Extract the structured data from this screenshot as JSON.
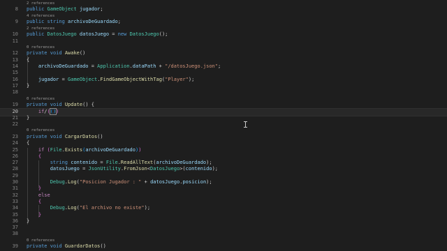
{
  "editor": {
    "lines": [
      {
        "ln": "8",
        "lens": "2 references",
        "tokens": [
          {
            "t": "public",
            "c": "kw"
          },
          {
            "t": " "
          },
          {
            "t": "GameObject",
            "c": "ty"
          },
          {
            "t": " "
          },
          {
            "t": "jugador",
            "c": "id"
          },
          {
            "t": ";"
          }
        ]
      },
      {
        "ln": "9",
        "lens": "4 references",
        "tokens": [
          {
            "t": "public",
            "c": "kw"
          },
          {
            "t": " "
          },
          {
            "t": "string",
            "c": "kw"
          },
          {
            "t": " "
          },
          {
            "t": "archivoDeGuardado",
            "c": "id"
          },
          {
            "t": ";"
          }
        ]
      },
      {
        "ln": "10",
        "lens": "2 references",
        "tokens": [
          {
            "t": "public",
            "c": "kw"
          },
          {
            "t": " "
          },
          {
            "t": "DatosJuego",
            "c": "ty"
          },
          {
            "t": " "
          },
          {
            "t": "datosJuego",
            "c": "id"
          },
          {
            "t": " = "
          },
          {
            "t": "new",
            "c": "kw"
          },
          {
            "t": " "
          },
          {
            "t": "DatosJuego",
            "c": "ty"
          },
          {
            "t": "();"
          }
        ]
      },
      {
        "ln": "11",
        "tokens": []
      },
      {
        "ln": "12",
        "lens": "0 references",
        "tokens": [
          {
            "t": "private",
            "c": "kw"
          },
          {
            "t": " "
          },
          {
            "t": "void",
            "c": "kw"
          },
          {
            "t": " "
          },
          {
            "t": "Awake",
            "c": "fn"
          },
          {
            "t": "()"
          }
        ]
      },
      {
        "ln": "13",
        "tokens": [
          {
            "t": "{"
          }
        ]
      },
      {
        "ln": "14",
        "tokens": [
          {
            "t": "    "
          },
          {
            "t": "archivoDeGuardado",
            "c": "id"
          },
          {
            "t": " = "
          },
          {
            "t": "Application",
            "c": "ty"
          },
          {
            "t": "."
          },
          {
            "t": "dataPath",
            "c": "id"
          },
          {
            "t": " + "
          },
          {
            "t": "\"/datosJuego.json\"",
            "c": "str"
          },
          {
            "t": ";"
          }
        ]
      },
      {
        "ln": "15",
        "tokens": []
      },
      {
        "ln": "16",
        "tokens": [
          {
            "t": "    "
          },
          {
            "t": "jugador",
            "c": "id"
          },
          {
            "t": " = "
          },
          {
            "t": "GameObject",
            "c": "ty"
          },
          {
            "t": "."
          },
          {
            "t": "FindGameObjectWithTag",
            "c": "fn"
          },
          {
            "t": "("
          },
          {
            "t": "\"Player\"",
            "c": "str"
          },
          {
            "t": ");"
          }
        ]
      },
      {
        "ln": "17",
        "tokens": [
          {
            "t": "}"
          }
        ]
      },
      {
        "ln": "18",
        "tokens": []
      },
      {
        "ln": "19",
        "lens": "0 references",
        "tokens": [
          {
            "t": "private",
            "c": "kw"
          },
          {
            "t": " "
          },
          {
            "t": "void",
            "c": "kw"
          },
          {
            "t": " "
          },
          {
            "t": "Update",
            "c": "fn"
          },
          {
            "t": "()"
          },
          {
            "t": " {"
          }
        ]
      },
      {
        "ln": "20",
        "current": true,
        "tokens": [
          {
            "t": "    "
          },
          {
            "t": "if",
            "c": "ctl"
          },
          {
            "t": "/"
          },
          {
            "t": "(",
            "c": "br2"
          },
          {
            "t": "()",
            "c": "br3 cursor-box"
          },
          {
            "t": ")",
            "c": "br2"
          }
        ]
      },
      {
        "ln": "21",
        "tokens": [
          {
            "t": "}"
          }
        ]
      },
      {
        "ln": "22",
        "tokens": []
      },
      {
        "ln": "23",
        "lens": "0 references",
        "tokens": [
          {
            "t": "private",
            "c": "kw"
          },
          {
            "t": " "
          },
          {
            "t": "void",
            "c": "kw"
          },
          {
            "t": " "
          },
          {
            "t": "CargarDatos",
            "c": "fn"
          },
          {
            "t": "()"
          }
        ]
      },
      {
        "ln": "24",
        "tokens": [
          {
            "t": "{"
          }
        ]
      },
      {
        "ln": "25",
        "tokens": [
          {
            "t": "    "
          },
          {
            "t": "if",
            "c": "ctl"
          },
          {
            "t": " "
          },
          {
            "t": "(",
            "c": "br2"
          },
          {
            "t": "File",
            "c": "ty"
          },
          {
            "t": "."
          },
          {
            "t": "Exists",
            "c": "fn"
          },
          {
            "t": "(",
            "c": "br3"
          },
          {
            "t": "archivoDeGuardado",
            "c": "id"
          },
          {
            "t": ")",
            "c": "br3"
          },
          {
            "t": ")",
            "c": "br2"
          }
        ]
      },
      {
        "ln": "26",
        "tokens": [
          {
            "t": "    "
          },
          {
            "t": "{",
            "c": "br2"
          }
        ]
      },
      {
        "ln": "27",
        "tokens": [
          {
            "t": "        "
          },
          {
            "t": "string",
            "c": "kw"
          },
          {
            "t": " "
          },
          {
            "t": "contenido",
            "c": "id"
          },
          {
            "t": " = "
          },
          {
            "t": "File",
            "c": "ty"
          },
          {
            "t": "."
          },
          {
            "t": "ReadAllText",
            "c": "fn"
          },
          {
            "t": "("
          },
          {
            "t": "archivoDeGuardado",
            "c": "id"
          },
          {
            "t": ");"
          }
        ]
      },
      {
        "ln": "28",
        "tokens": [
          {
            "t": "        "
          },
          {
            "t": "datosJuego",
            "c": "id"
          },
          {
            "t": " = "
          },
          {
            "t": "JsonUtility",
            "c": "ty"
          },
          {
            "t": "."
          },
          {
            "t": "FromJson",
            "c": "fn"
          },
          {
            "t": "<"
          },
          {
            "t": "DatosJuego",
            "c": "ty"
          },
          {
            "t": ">("
          },
          {
            "t": "contenido",
            "c": "id"
          },
          {
            "t": ");"
          }
        ]
      },
      {
        "ln": "29",
        "tokens": []
      },
      {
        "ln": "30",
        "tokens": [
          {
            "t": "        "
          },
          {
            "t": "Debug",
            "c": "ty"
          },
          {
            "t": "."
          },
          {
            "t": "Log",
            "c": "fn"
          },
          {
            "t": "("
          },
          {
            "t": "\"Posicion Jugador : \"",
            "c": "str"
          },
          {
            "t": " + "
          },
          {
            "t": "datosJuego",
            "c": "id"
          },
          {
            "t": "."
          },
          {
            "t": "posicion",
            "c": "id"
          },
          {
            "t": ");"
          }
        ]
      },
      {
        "ln": "31",
        "tokens": [
          {
            "t": "    "
          },
          {
            "t": "}",
            "c": "br2"
          }
        ]
      },
      {
        "ln": "32",
        "tokens": [
          {
            "t": "    "
          },
          {
            "t": "else",
            "c": "ctl"
          }
        ]
      },
      {
        "ln": "33",
        "tokens": [
          {
            "t": "    "
          },
          {
            "t": "{",
            "c": "br2"
          }
        ]
      },
      {
        "ln": "34",
        "tokens": [
          {
            "t": "        "
          },
          {
            "t": "Debug",
            "c": "ty"
          },
          {
            "t": "."
          },
          {
            "t": "Log",
            "c": "fn"
          },
          {
            "t": "("
          },
          {
            "t": "\"El archivo no existe\"",
            "c": "str"
          },
          {
            "t": ");"
          }
        ]
      },
      {
        "ln": "35",
        "tokens": [
          {
            "t": "    "
          },
          {
            "t": "}",
            "c": "br2"
          }
        ]
      },
      {
        "ln": "36",
        "tokens": [
          {
            "t": "}"
          }
        ]
      },
      {
        "ln": "37",
        "tokens": []
      },
      {
        "ln": "38",
        "tokens": []
      },
      {
        "ln": "39",
        "lens": "0 references",
        "tokens": [
          {
            "t": "private",
            "c": "kw"
          },
          {
            "t": " "
          },
          {
            "t": "void",
            "c": "kw"
          },
          {
            "t": " "
          },
          {
            "t": "GuardarDatos",
            "c": "fn"
          },
          {
            "t": "()"
          }
        ]
      }
    ]
  }
}
